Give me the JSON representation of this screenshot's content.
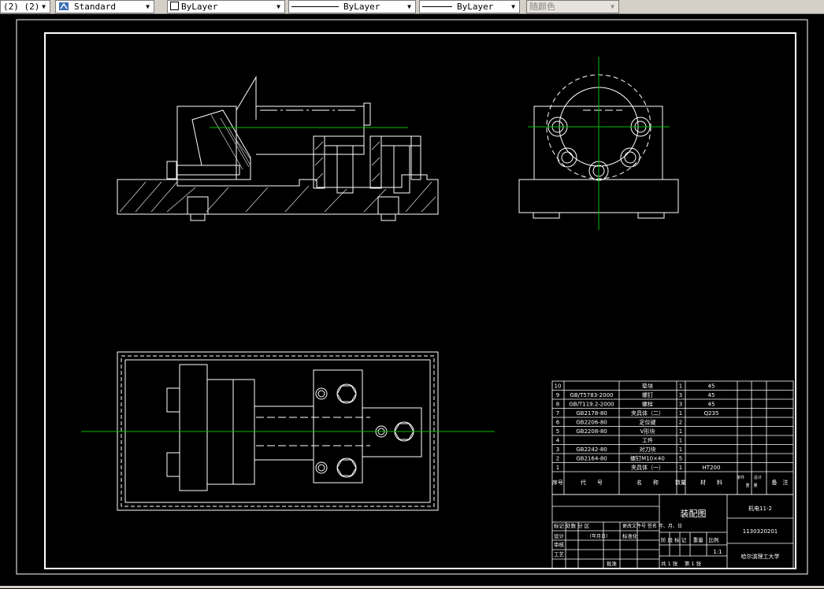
{
  "toolbar": {
    "layer_combo": "(2) (2)",
    "text_style": "Standard",
    "color": "ByLayer",
    "linetype": "ByLayer",
    "lineweight": "ByLayer",
    "plot_style": "随颜色"
  },
  "parts_list": [
    {
      "no": "10",
      "code": "",
      "name": "垫块",
      "qty": "1",
      "material": "45"
    },
    {
      "no": "9",
      "code": "GB/T5783-2000",
      "name": "螺钉",
      "qty": "3",
      "material": "45"
    },
    {
      "no": "8",
      "code": "GB/T119.2-2000",
      "name": "螺栓",
      "qty": "3",
      "material": "45"
    },
    {
      "no": "7",
      "code": "GB2178-80",
      "name": "夹具体（二）",
      "qty": "1",
      "material": "Q235"
    },
    {
      "no": "6",
      "code": "GB2206-80",
      "name": "定位键",
      "qty": "2",
      "material": ""
    },
    {
      "no": "5",
      "code": "GB2208-80",
      "name": "V形块",
      "qty": "1",
      "material": ""
    },
    {
      "no": "4",
      "code": "",
      "name": "工件",
      "qty": "1",
      "material": ""
    },
    {
      "no": "3",
      "code": "GB2242-80",
      "name": "对刀块",
      "qty": "1",
      "material": ""
    },
    {
      "no": "2",
      "code": "GB2164-80",
      "name": "螺钉M10×40",
      "qty": "5",
      "material": ""
    },
    {
      "no": "1",
      "code": "",
      "name": "夹具体（一）",
      "qty": "1",
      "material": "HT200"
    }
  ],
  "parts_header": {
    "no": "序号",
    "code": "代　　号",
    "name": "名　　称",
    "qty": "数量",
    "material": "材　　料",
    "unit_weight": "单件",
    "total_weight": "总计",
    "weight": "重　量",
    "remark": "备　注"
  },
  "title_block": {
    "drawing_name": "装配图",
    "drawing_code": "机电11-2",
    "student_id": "1130320201",
    "school": "哈尔滨理工大学",
    "scale": "1:1",
    "stage_labels": "阶 段 标 记　 重量　比例",
    "sheet_info": "共  1  张　 第  1  张",
    "row_mark": "标记  处数   分  区",
    "row_design": "设计",
    "row_check": "审核",
    "row_process": "工艺",
    "row_approve": "批准",
    "sign_date": "（年月日）",
    "change_doc": "更改文件号  签名  年、月、日",
    "standardize": "标准化"
  }
}
